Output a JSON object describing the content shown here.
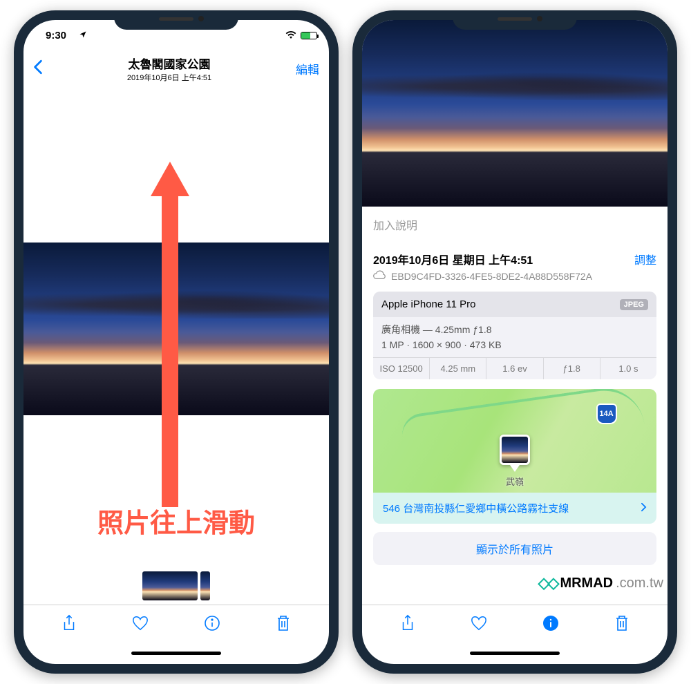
{
  "phone1": {
    "status": {
      "time": "9:30",
      "wifi": true,
      "battery_charging": true
    },
    "nav": {
      "title": "太魯閣國家公園",
      "subtitle": "2019年10月6日 上午4:51",
      "edit": "編輯"
    },
    "annotation": "照片往上滑動"
  },
  "phone2": {
    "caption_placeholder": "加入說明",
    "date": "2019年10月6日 星期日 上午4:51",
    "adjust": "調整",
    "filename": "EBD9C4FD-3326-4FE5-8DE2-4A88D558F72A",
    "exif": {
      "device": "Apple iPhone 11 Pro",
      "format": "JPEG",
      "lens": "廣角相機 — 4.25mm ƒ1.8",
      "dims": "1 MP · 1600 × 900 · 473 KB",
      "iso": "ISO 12500",
      "focal": "4.25 mm",
      "ev": "1.6 ev",
      "aperture": "ƒ1.8",
      "shutter": "1.0 s"
    },
    "map": {
      "route_badge": "14A",
      "pin_label": "武嶺",
      "address": "546 台灣南投縣仁愛鄉中橫公路霧社支線"
    },
    "show_all": "顯示於所有照片"
  },
  "watermark": {
    "brand": "MRMAD",
    "domain": ".com.tw"
  }
}
